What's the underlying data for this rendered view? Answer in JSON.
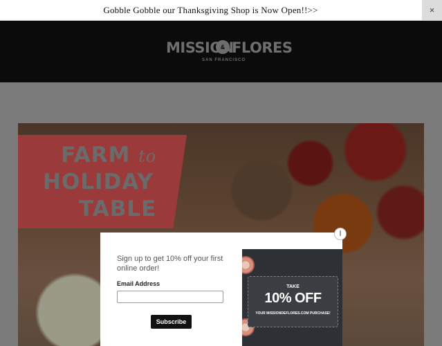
{
  "announcement": {
    "text": "Gobble Gobble our Thanksgiving Shop is Now Open!!>>",
    "close_glyph": "×"
  },
  "header": {
    "logo": {
      "left": "MISSION",
      "amp": "&",
      "right": "FLORES",
      "sub": "SAN FRANCISCO"
    }
  },
  "hero": {
    "line1": "FARM",
    "line1_to": "to",
    "line2": "HOLIDAY",
    "line3": "TABLE"
  },
  "modal": {
    "text": "Sign up to get 10% off your first online order!",
    "email_label": "Email Address",
    "email_value": "",
    "email_placeholder": "",
    "subscribe_label": "Subscribe",
    "close_glyph": "l",
    "promo": {
      "take": "TAKE",
      "big": "10% OFF",
      "fine": "YOUR MISSIONDEFLORES.COM PURCHASE!"
    }
  },
  "colors": {
    "header_bg": "#0b0b0b",
    "banner_red": "#9b3a3a",
    "overlay": "#7b7b7b",
    "button_bg": "#111111"
  }
}
